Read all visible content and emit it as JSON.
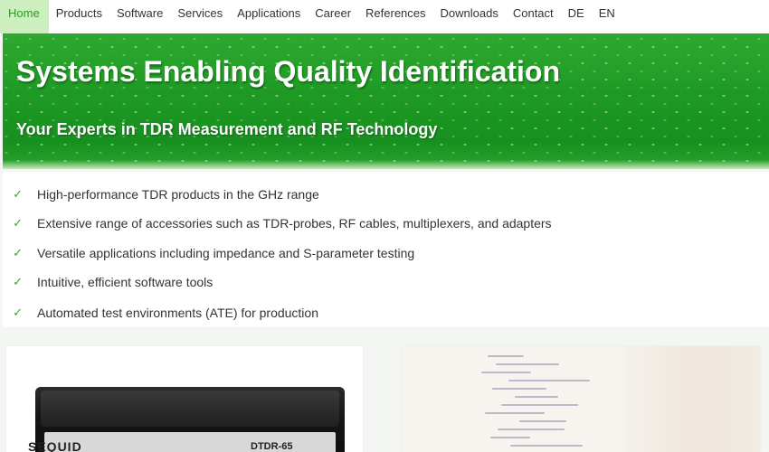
{
  "nav": {
    "items": [
      {
        "label": "Home",
        "active": true
      },
      {
        "label": "Products"
      },
      {
        "label": "Software"
      },
      {
        "label": "Services"
      },
      {
        "label": "Applications"
      },
      {
        "label": "Career"
      },
      {
        "label": "References"
      },
      {
        "label": "Downloads"
      },
      {
        "label": "Contact"
      },
      {
        "label": "DE"
      },
      {
        "label": "EN"
      }
    ]
  },
  "hero": {
    "title": "Systems Enabling Quality Identification",
    "subtitle": "Your Experts in TDR Measurement and RF Technology"
  },
  "features": {
    "check_icon": "checkmark-icon",
    "items": [
      "High-performance TDR products in the GHz range",
      "Extensive range of accessories such as TDR-probes, RF cables, multiplexers, and adapters",
      "Versatile applications including impedance and S-parameter testing",
      "Intuitive, efficient software tools",
      "Automated test environments (ATE) for production"
    ]
  },
  "cards": {
    "product": {
      "brand": "SEQUID",
      "model": "DTDR-65"
    },
    "software": {
      "image": "code-screenshot"
    }
  },
  "colors": {
    "accent": "#2fa830",
    "nav_active_bg": "#cdeebe",
    "hero_green": "#1e9a24"
  }
}
